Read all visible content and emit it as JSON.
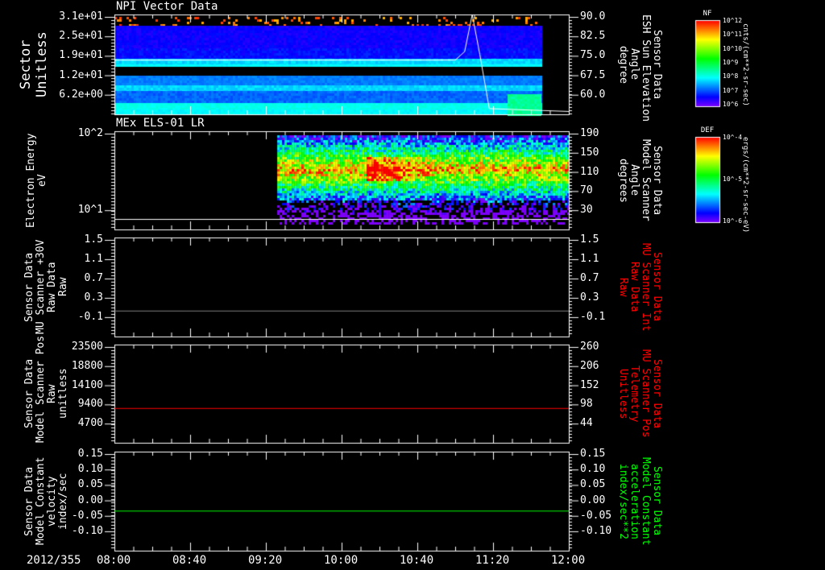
{
  "date_label": "2012/355",
  "time_ticks": [
    "08:00",
    "08:40",
    "09:20",
    "10:00",
    "10:40",
    "11:20",
    "12:00"
  ],
  "chart_data": [
    {
      "type": "heatmap",
      "title": "NPI Vector Data",
      "ylabel": "Sector\nUnitless",
      "yticks": [
        "3.1e+01",
        "2.5e+01",
        "1.9e+01",
        "1.2e+01",
        "6.2e+00"
      ],
      "y2label": "Sensor Data\nESH Sun Elevation\nAngle\ndegree",
      "y2ticks": [
        "90.0",
        "82.5",
        "75.0",
        "67.5",
        "60.0"
      ],
      "y2lim": [
        55,
        90
      ],
      "colorbar": {
        "label": "NF",
        "ticks": [
          "10^12",
          "10^11",
          "10^10",
          "10^9",
          "10^8",
          "10^7",
          "10^6"
        ],
        "units": "cnts/(cm**2-sr-sec)"
      },
      "line": {
        "color": "#ffffff",
        "x": [
          "08:00",
          "11:00",
          "11:05",
          "11:09",
          "11:13",
          "11:18",
          "12:00"
        ],
        "y": [
          74,
          74,
          77,
          90,
          76,
          57,
          56
        ]
      }
    },
    {
      "type": "heatmap",
      "title": "MEx ELS-01 LR",
      "ylabel": "Electron Energy\neV",
      "yticks": [
        "10^2",
        "10^1"
      ],
      "y2label": "Sensor Data\nModel Scanner\nAngle\ndegrees",
      "y2ticks": [
        "190",
        "150",
        "110",
        "70",
        "30"
      ],
      "colorbar": {
        "label": "DEF",
        "ticks": [
          "10^-4",
          "10^-5",
          "10^-6"
        ],
        "units": "ergs/(cm**2-sr-sec-eV)"
      },
      "data_start": "09:26",
      "line": {
        "color": "#ffffff",
        "y2": 15
      }
    },
    {
      "type": "line",
      "ylabel": "Sensor Data\nMU Scanner +30V\nRaw Data\nRaw",
      "yticks": [
        "1.5",
        "1.1",
        "0.7",
        "0.3",
        "-0.1"
      ],
      "ylim": [
        -0.52,
        1.5
      ],
      "y2label": "Sensor Data\nMU Scanner Int\nRaw Data\nRaw",
      "y2ticks": [
        "1.5",
        "1.1",
        "0.7",
        "0.3",
        "-0.1"
      ],
      "y2color": "#ff0000",
      "series": [
        {
          "color": "#808080",
          "x": [
            "08:00",
            "12:00"
          ],
          "y": [
            0.0,
            0.0
          ]
        }
      ]
    },
    {
      "type": "line",
      "ylabel": "Sensor Data\nModel Scanner Pos\nRaw\nunitless",
      "yticks": [
        "23500",
        "18800",
        "14100",
        "9400",
        "4700"
      ],
      "ylim": [
        -1570,
        23500
      ],
      "y2label": "Sensor Data\nMU Scanner Pos\nTelemetry\nUnitless",
      "y2ticks": [
        "260",
        "206",
        "152",
        "98",
        "44"
      ],
      "y2color": "#ff0000",
      "series": [
        {
          "color": "#ff0000",
          "x": [
            "08:00",
            "12:00"
          ],
          "y": [
            7200,
            7200
          ]
        }
      ]
    },
    {
      "type": "line",
      "ylabel": "Sensor Data\nModel Constant\nvelocity\nindex/sec",
      "yticks": [
        "0.15",
        "0.10",
        "0.05",
        "0.00",
        "-0.05",
        "-0.10"
      ],
      "ylim": [
        -0.1,
        0.15
      ],
      "y2label": "Sensor Data\nModel Constant\nacceleration\nindex/sec**2",
      "y2ticks": [
        "0.15",
        "0.10",
        "0.05",
        "0.00",
        "-0.05",
        "-0.10"
      ],
      "y2color": "#00ff00",
      "series": [
        {
          "color": "#00ff00",
          "x": [
            "08:00",
            "12:00"
          ],
          "y": [
            0,
            0
          ]
        }
      ]
    }
  ]
}
